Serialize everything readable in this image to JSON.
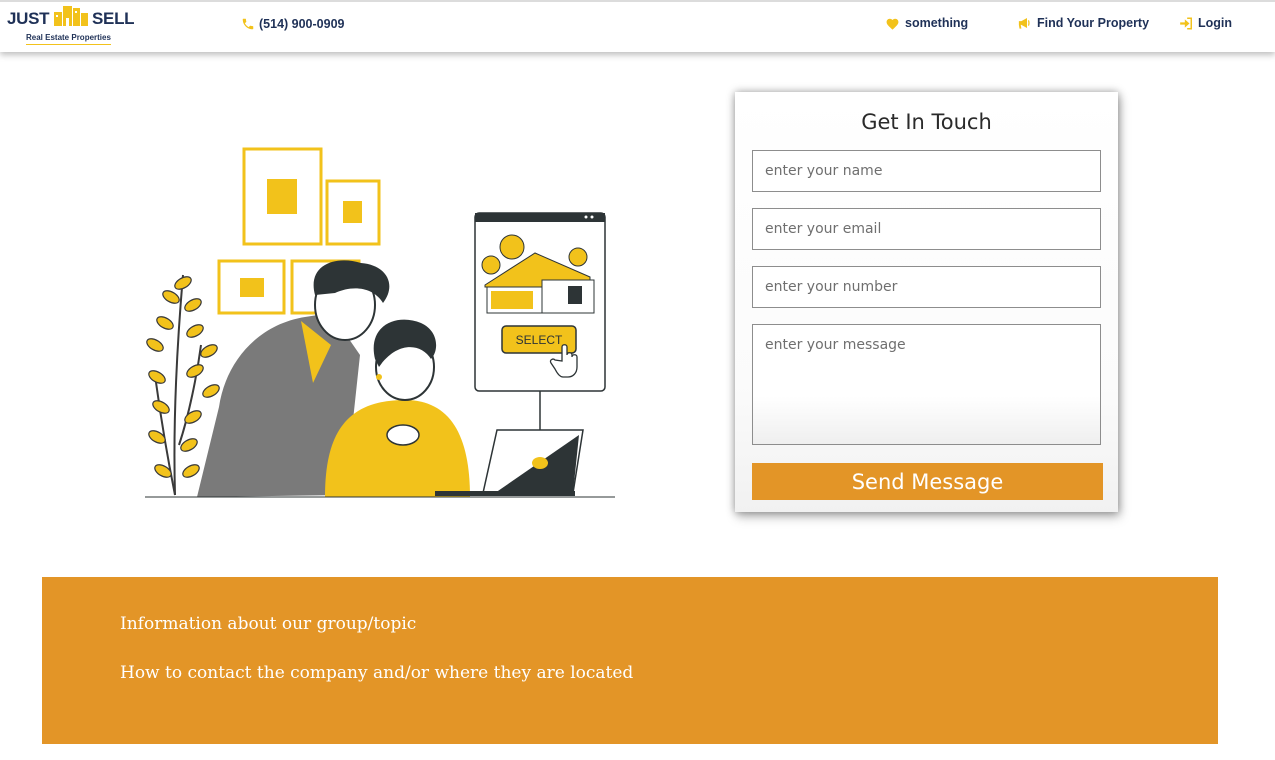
{
  "brand": {
    "name_left": "JUST",
    "name_right": "SELL",
    "tagline": "Real Estate Properties",
    "accent_color": "#f2c21b",
    "navy_color": "#1f3157"
  },
  "header": {
    "phone": {
      "icon": "phone-icon",
      "text": "(514) 900-0909"
    },
    "nav": [
      {
        "icon": "heart-icon",
        "label": "something"
      },
      {
        "icon": "megaphone-icon",
        "label": "Find Your Property"
      },
      {
        "icon": "login-icon",
        "label": "Login"
      }
    ]
  },
  "illustration": {
    "button_label": "SELECT"
  },
  "contact_form": {
    "title": "Get In Touch",
    "name_placeholder": "enter your name",
    "email_placeholder": "enter your email",
    "number_placeholder": "enter your number",
    "message_placeholder": "enter your message",
    "submit_label": "Send Message",
    "button_color": "#e39527"
  },
  "footer": {
    "lines": [
      "Information about our group/topic",
      "How to contact the company and/or where they are located"
    ],
    "background_color": "#e39527"
  }
}
